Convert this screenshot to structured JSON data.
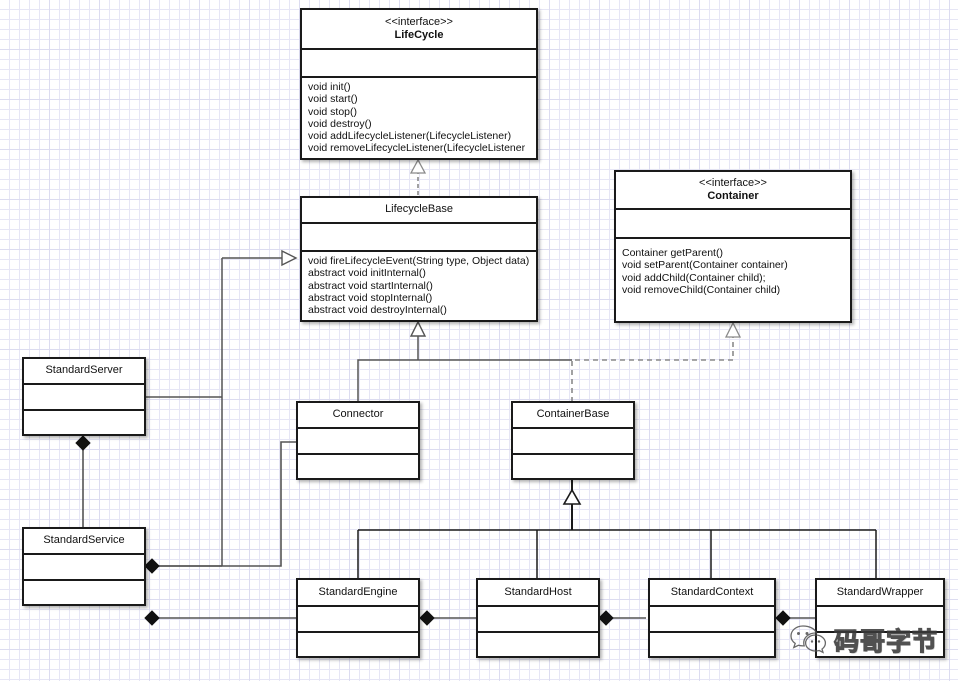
{
  "diagram": {
    "title": "Tomcat LifeCycle / Container UML class diagram",
    "background": "#ffffff",
    "grid_color": "#e6e6f5",
    "line_color": "#555555",
    "box_border_color": "#1a1a1a"
  },
  "classes": {
    "lifecycle": {
      "stereotype": "<<interface>>",
      "name": "LifeCycle",
      "attributes": [],
      "operations": [
        "void init()",
        "void start()",
        "void stop()",
        "void destroy()",
        "void addLifecycleListener(LifecycleListener)",
        "void removeLifecycleListener(LifecycleListener"
      ]
    },
    "container": {
      "stereotype": "<<interface>>",
      "name": "Container",
      "attributes": [],
      "operations": [
        " Container getParent()",
        "void setParent(Container container)",
        "void addChild(Container child);",
        "void removeChild(Container child)"
      ]
    },
    "lifecycle_base": {
      "stereotype": "",
      "name": "LifecycleBase",
      "attributes": [],
      "operations": [
        "void fireLifecycleEvent(String type, Object data)",
        "abstract void initInternal()",
        "abstract void startInternal()",
        "abstract void stopInternal()",
        "abstract void destroyInternal()"
      ]
    },
    "standard_server": {
      "stereotype": "",
      "name": "StandardServer",
      "attributes": [],
      "operations": []
    },
    "standard_service": {
      "stereotype": "",
      "name": "StandardService",
      "attributes": [],
      "operations": []
    },
    "connector": {
      "stereotype": "",
      "name": "Connector",
      "attributes": [],
      "operations": []
    },
    "container_base": {
      "stereotype": "",
      "name": "ContainerBase",
      "attributes": [],
      "operations": []
    },
    "standard_engine": {
      "stereotype": "",
      "name": "StandardEngine",
      "attributes": [],
      "operations": []
    },
    "standard_host": {
      "stereotype": "",
      "name": "StandardHost",
      "attributes": [],
      "operations": []
    },
    "standard_context": {
      "stereotype": "",
      "name": "StandardContext",
      "attributes": [],
      "operations": []
    },
    "standard_wrapper": {
      "stereotype": "",
      "name": "StandardWrapper",
      "attributes": [],
      "operations": []
    }
  },
  "relationships": [
    {
      "type": "realization",
      "from": "LifecycleBase",
      "to": "LifeCycle",
      "style": "dashed",
      "arrow": "hollow-triangle"
    },
    {
      "type": "realization",
      "from": "ContainerBase",
      "to": "Container",
      "style": "dashed",
      "arrow": "hollow-triangle"
    },
    {
      "type": "generalization",
      "from": "Connector",
      "to": "LifecycleBase",
      "style": "solid",
      "arrow": "hollow-triangle"
    },
    {
      "type": "generalization",
      "from": "ContainerBase",
      "to": "LifecycleBase",
      "style": "solid",
      "arrow": "hollow-triangle"
    },
    {
      "type": "generalization",
      "from": "StandardServer",
      "to": "LifecycleBase",
      "style": "solid",
      "arrow": "hollow-triangle"
    },
    {
      "type": "generalization",
      "from": "StandardService",
      "to": "LifecycleBase",
      "style": "solid",
      "arrow": "hollow-triangle"
    },
    {
      "type": "generalization",
      "from": "StandardEngine",
      "to": "ContainerBase",
      "style": "solid",
      "arrow": "hollow-triangle"
    },
    {
      "type": "generalization",
      "from": "StandardHost",
      "to": "ContainerBase",
      "style": "solid",
      "arrow": "hollow-triangle"
    },
    {
      "type": "generalization",
      "from": "StandardContext",
      "to": "ContainerBase",
      "style": "solid",
      "arrow": "hollow-triangle"
    },
    {
      "type": "generalization",
      "from": "StandardWrapper",
      "to": "ContainerBase",
      "style": "solid",
      "arrow": "hollow-triangle"
    },
    {
      "type": "composition",
      "from": "StandardServer",
      "to": "StandardService",
      "style": "solid",
      "arrow": "filled-diamond"
    },
    {
      "type": "composition",
      "from": "StandardService",
      "to": "Connector",
      "style": "solid",
      "arrow": "filled-diamond"
    },
    {
      "type": "composition",
      "from": "StandardService",
      "to": "StandardEngine",
      "style": "solid",
      "arrow": "filled-diamond"
    },
    {
      "type": "composition",
      "from": "StandardEngine",
      "to": "StandardHost",
      "style": "solid",
      "arrow": "filled-diamond"
    },
    {
      "type": "composition",
      "from": "StandardHost",
      "to": "StandardContext",
      "style": "solid",
      "arrow": "filled-diamond"
    },
    {
      "type": "composition",
      "from": "StandardContext",
      "to": "StandardWrapper",
      "style": "solid",
      "arrow": "filled-diamond"
    }
  ],
  "watermark": {
    "text": "码哥字节",
    "icon": "wechat-icon"
  }
}
